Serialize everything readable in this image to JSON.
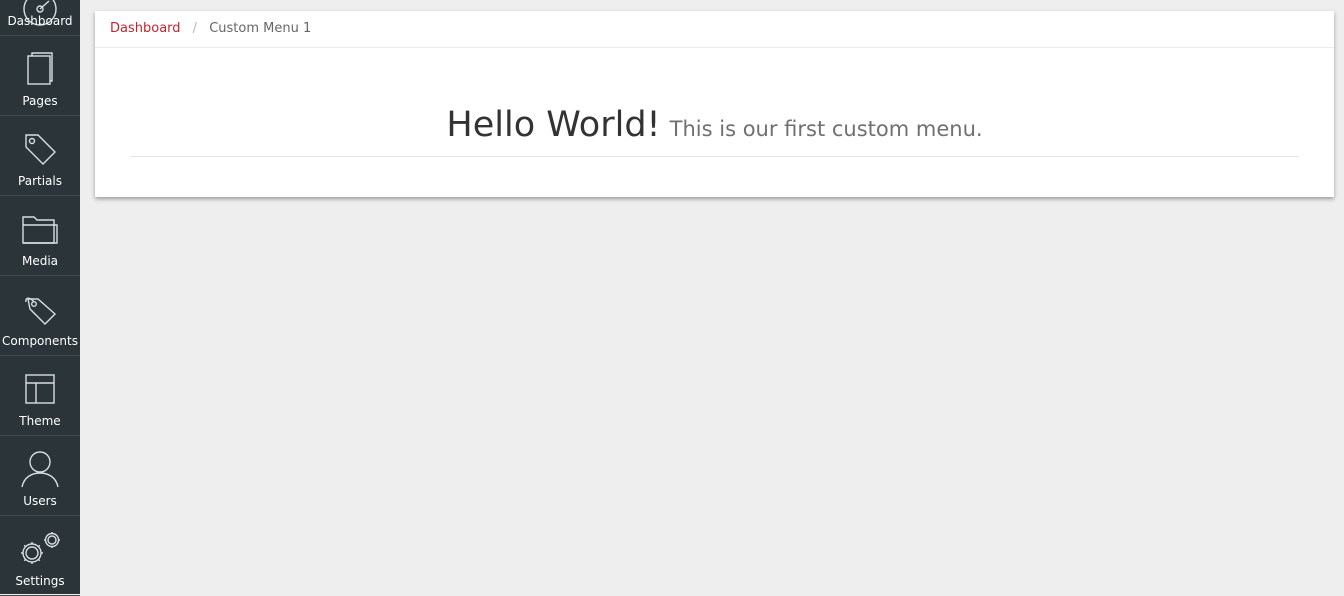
{
  "sidebar": {
    "items": [
      {
        "label": "Dashboard",
        "icon": "dashboard-icon"
      },
      {
        "label": "Pages",
        "icon": "pages-icon"
      },
      {
        "label": "Partials",
        "icon": "tag-icon"
      },
      {
        "label": "Media",
        "icon": "folder-icon"
      },
      {
        "label": "Components",
        "icon": "components-tag-icon"
      },
      {
        "label": "Theme",
        "icon": "layout-icon"
      },
      {
        "label": "Users",
        "icon": "user-icon"
      },
      {
        "label": "Settings",
        "icon": "gears-icon"
      }
    ]
  },
  "breadcrumb": {
    "link": "Dashboard",
    "separator": "/",
    "current": "Custom Menu 1"
  },
  "content": {
    "headline": "Hello World!",
    "subtext": "This is our first custom menu."
  },
  "colors": {
    "sidebar_bg": "#2b3438",
    "accent": "#c0262d",
    "page_bg": "#eeeeee"
  }
}
